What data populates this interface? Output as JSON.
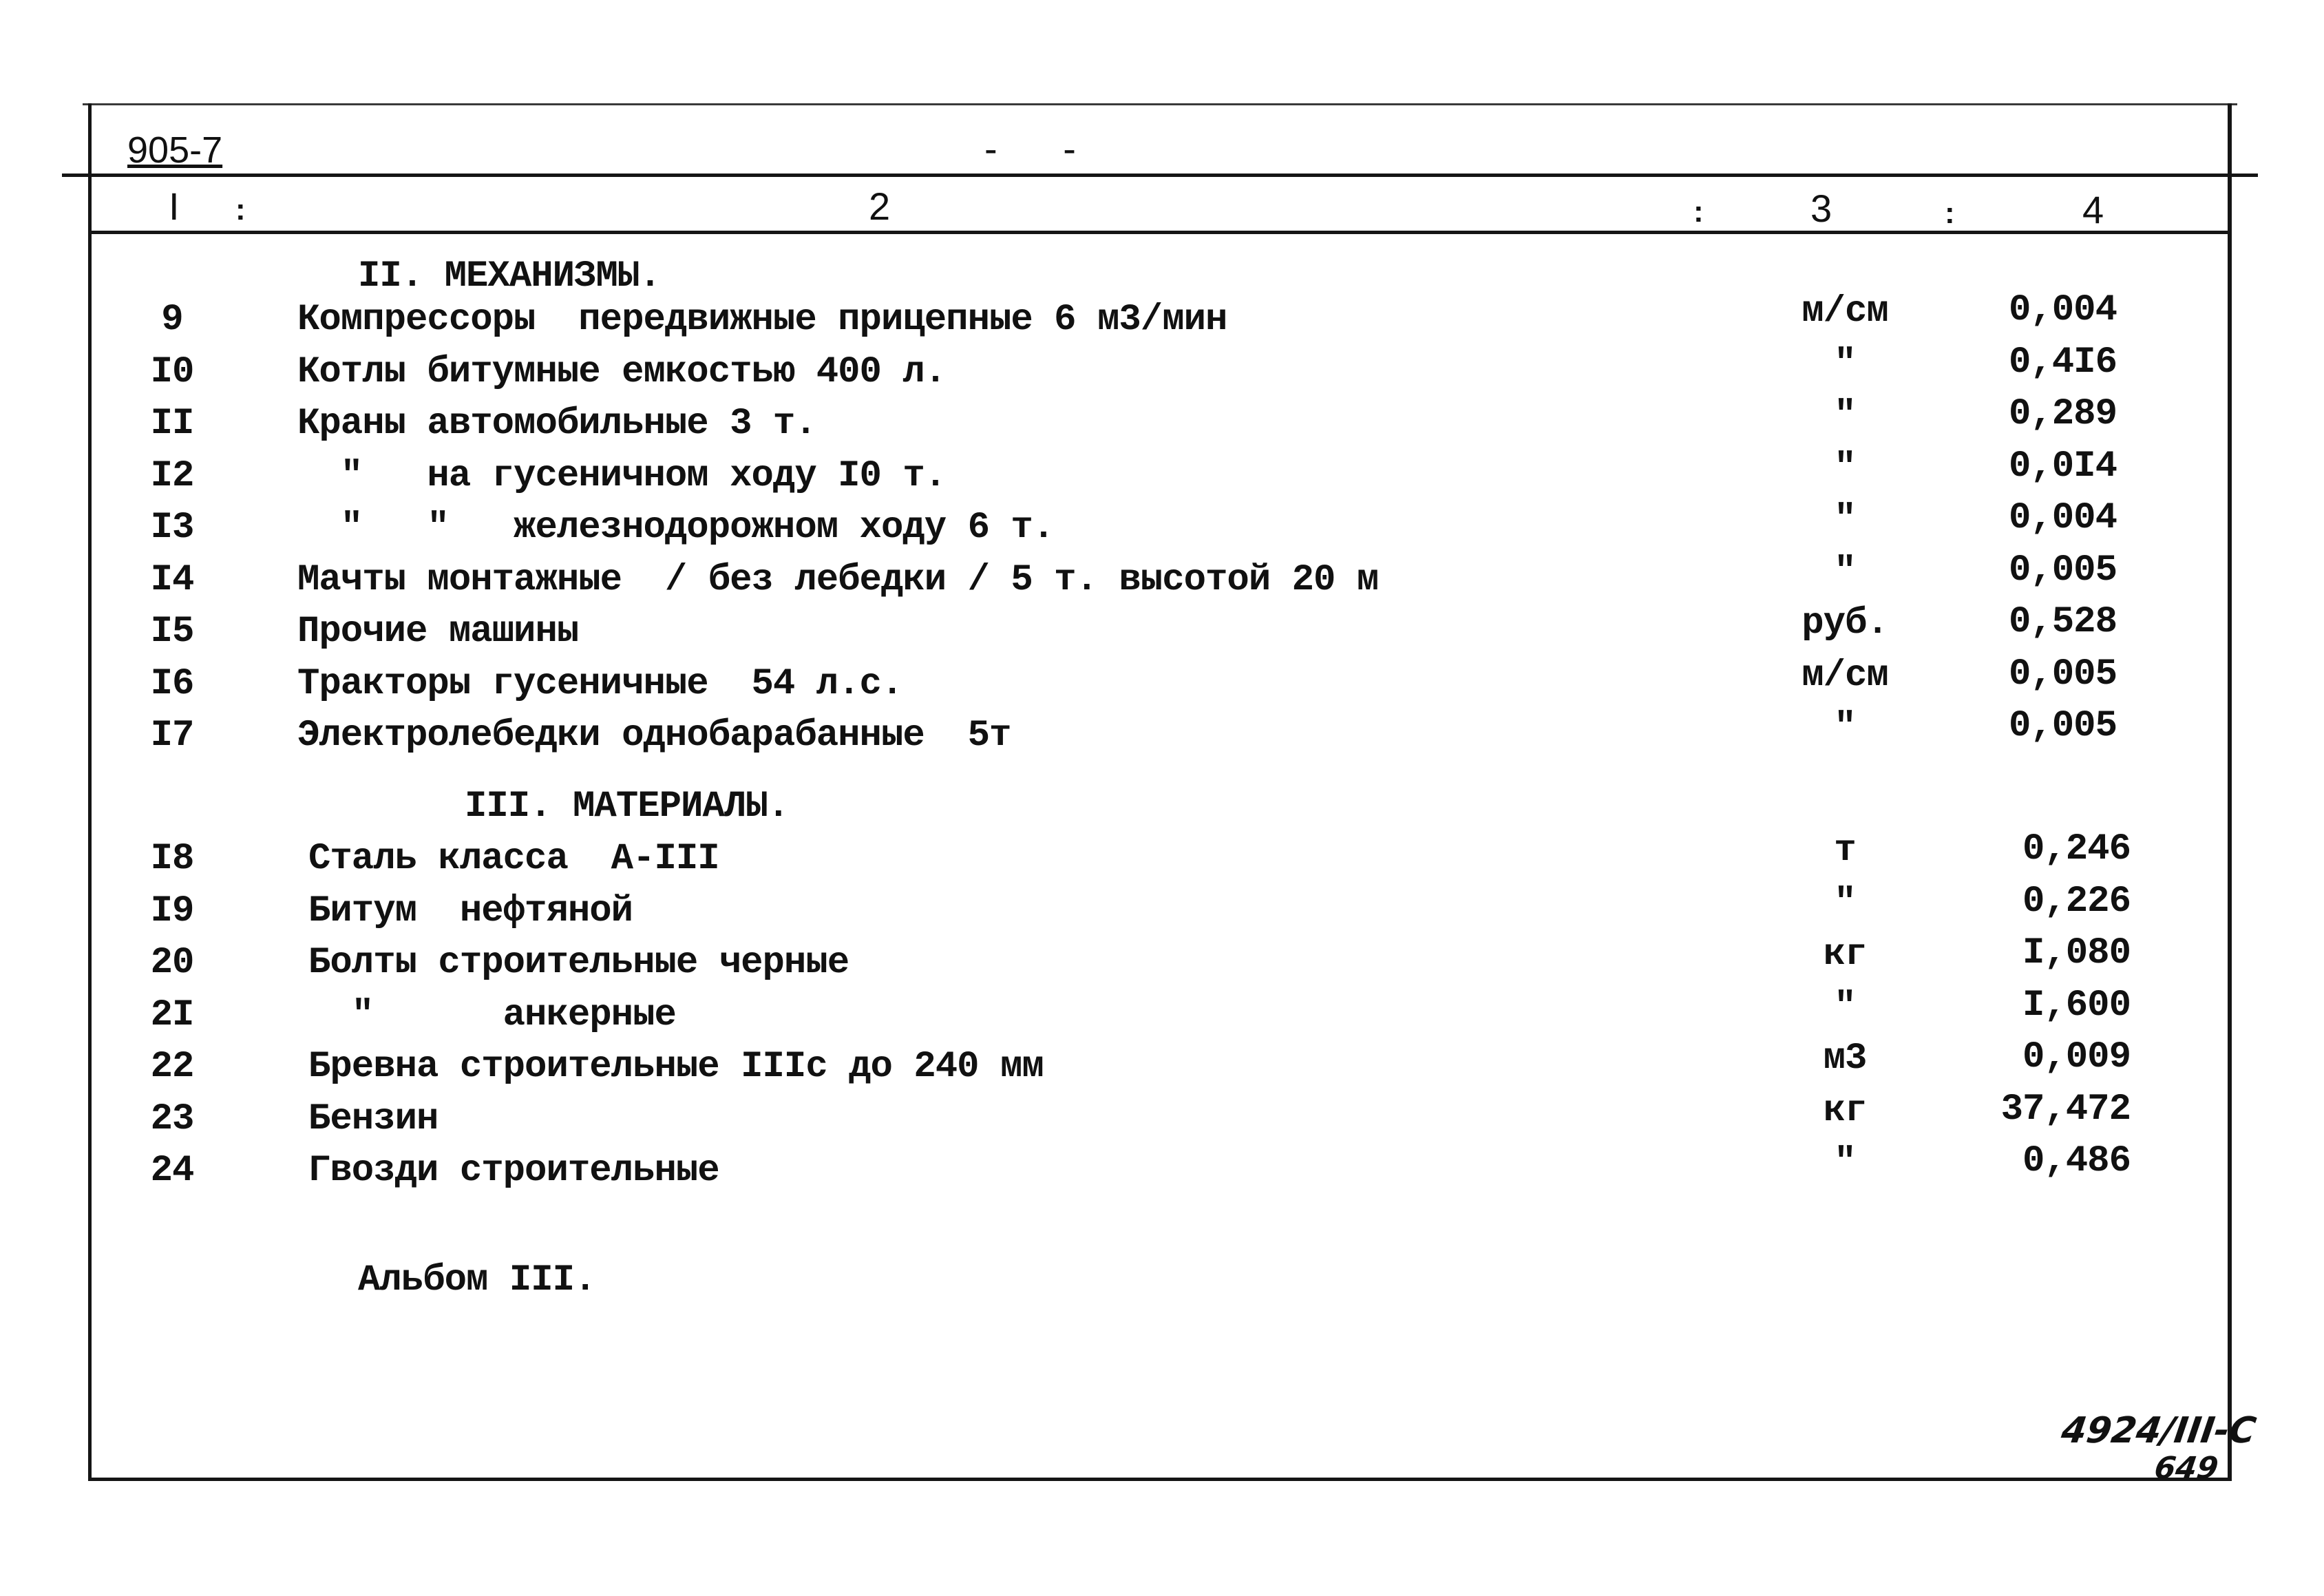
{
  "document": {
    "doc_code": "905-7",
    "page_mark": "- -",
    "header_columns": [
      "I",
      "2",
      "3",
      "4"
    ],
    "header_separator": ":",
    "sections": [
      {
        "title": "II. МЕХАНИЗМЫ.",
        "rows": [
          {
            "no": "9",
            "name": "Компрессоры  передвижные прицепные 6 м3/мин",
            "unit": "м/см",
            "value": "0,004"
          },
          {
            "no": "I0",
            "name": "Котлы битумные емкостью 400 л.",
            "unit": "\"",
            "value": "0,4I6"
          },
          {
            "no": "II",
            "name": "Краны автомобильные 3 т.",
            "unit": "\"",
            "value": "0,289"
          },
          {
            "no": "I2",
            "name": "  \"   на гусеничном ходу I0 т.",
            "unit": "\"",
            "value": "0,0I4"
          },
          {
            "no": "I3",
            "name": "  \"   \"   железнодорожном ходу 6 т.",
            "unit": "\"",
            "value": "0,004"
          },
          {
            "no": "I4",
            "name": "Мачты монтажные  / без лебедки / 5 т. высотой 20 м",
            "unit": "\"",
            "value": "0,005"
          },
          {
            "no": "I5",
            "name": "Прочие машины",
            "unit": "руб.",
            "value": "0,528"
          },
          {
            "no": "I6",
            "name": "Тракторы гусеничные  54 л.с.",
            "unit": "м/см",
            "value": "0,005"
          },
          {
            "no": "I7",
            "name": "Электролебедки однобарабанные  5т",
            "unit": "\"",
            "value": "0,005"
          }
        ]
      },
      {
        "title": "III. МАТЕРИАЛЫ.",
        "rows": [
          {
            "no": "I8",
            "name": "Сталь класса  А-III",
            "unit": "т",
            "value": "0,246"
          },
          {
            "no": "I9",
            "name": "Битум  нефтяной",
            "unit": "\"",
            "value": "0,226"
          },
          {
            "no": "20",
            "name": "Болты строительные черные",
            "unit": "кг",
            "value": "I,080"
          },
          {
            "no": "2I",
            "name": "  \"      анкерные",
            "unit": "\"",
            "value": "I,600"
          },
          {
            "no": "22",
            "name": "Бревна строительные IIIс до 240 мм",
            "unit": "м3",
            "value": "0,009"
          },
          {
            "no": "23",
            "name": "Бензин",
            "unit": "кг",
            "value": "37,472"
          },
          {
            "no": "24",
            "name": "Гвозди строительные",
            "unit": "\"",
            "value": "0,486"
          }
        ]
      }
    ],
    "footer_note": "Альбом III.",
    "stamp_line1": "4924/III-C",
    "stamp_line2": "649"
  }
}
